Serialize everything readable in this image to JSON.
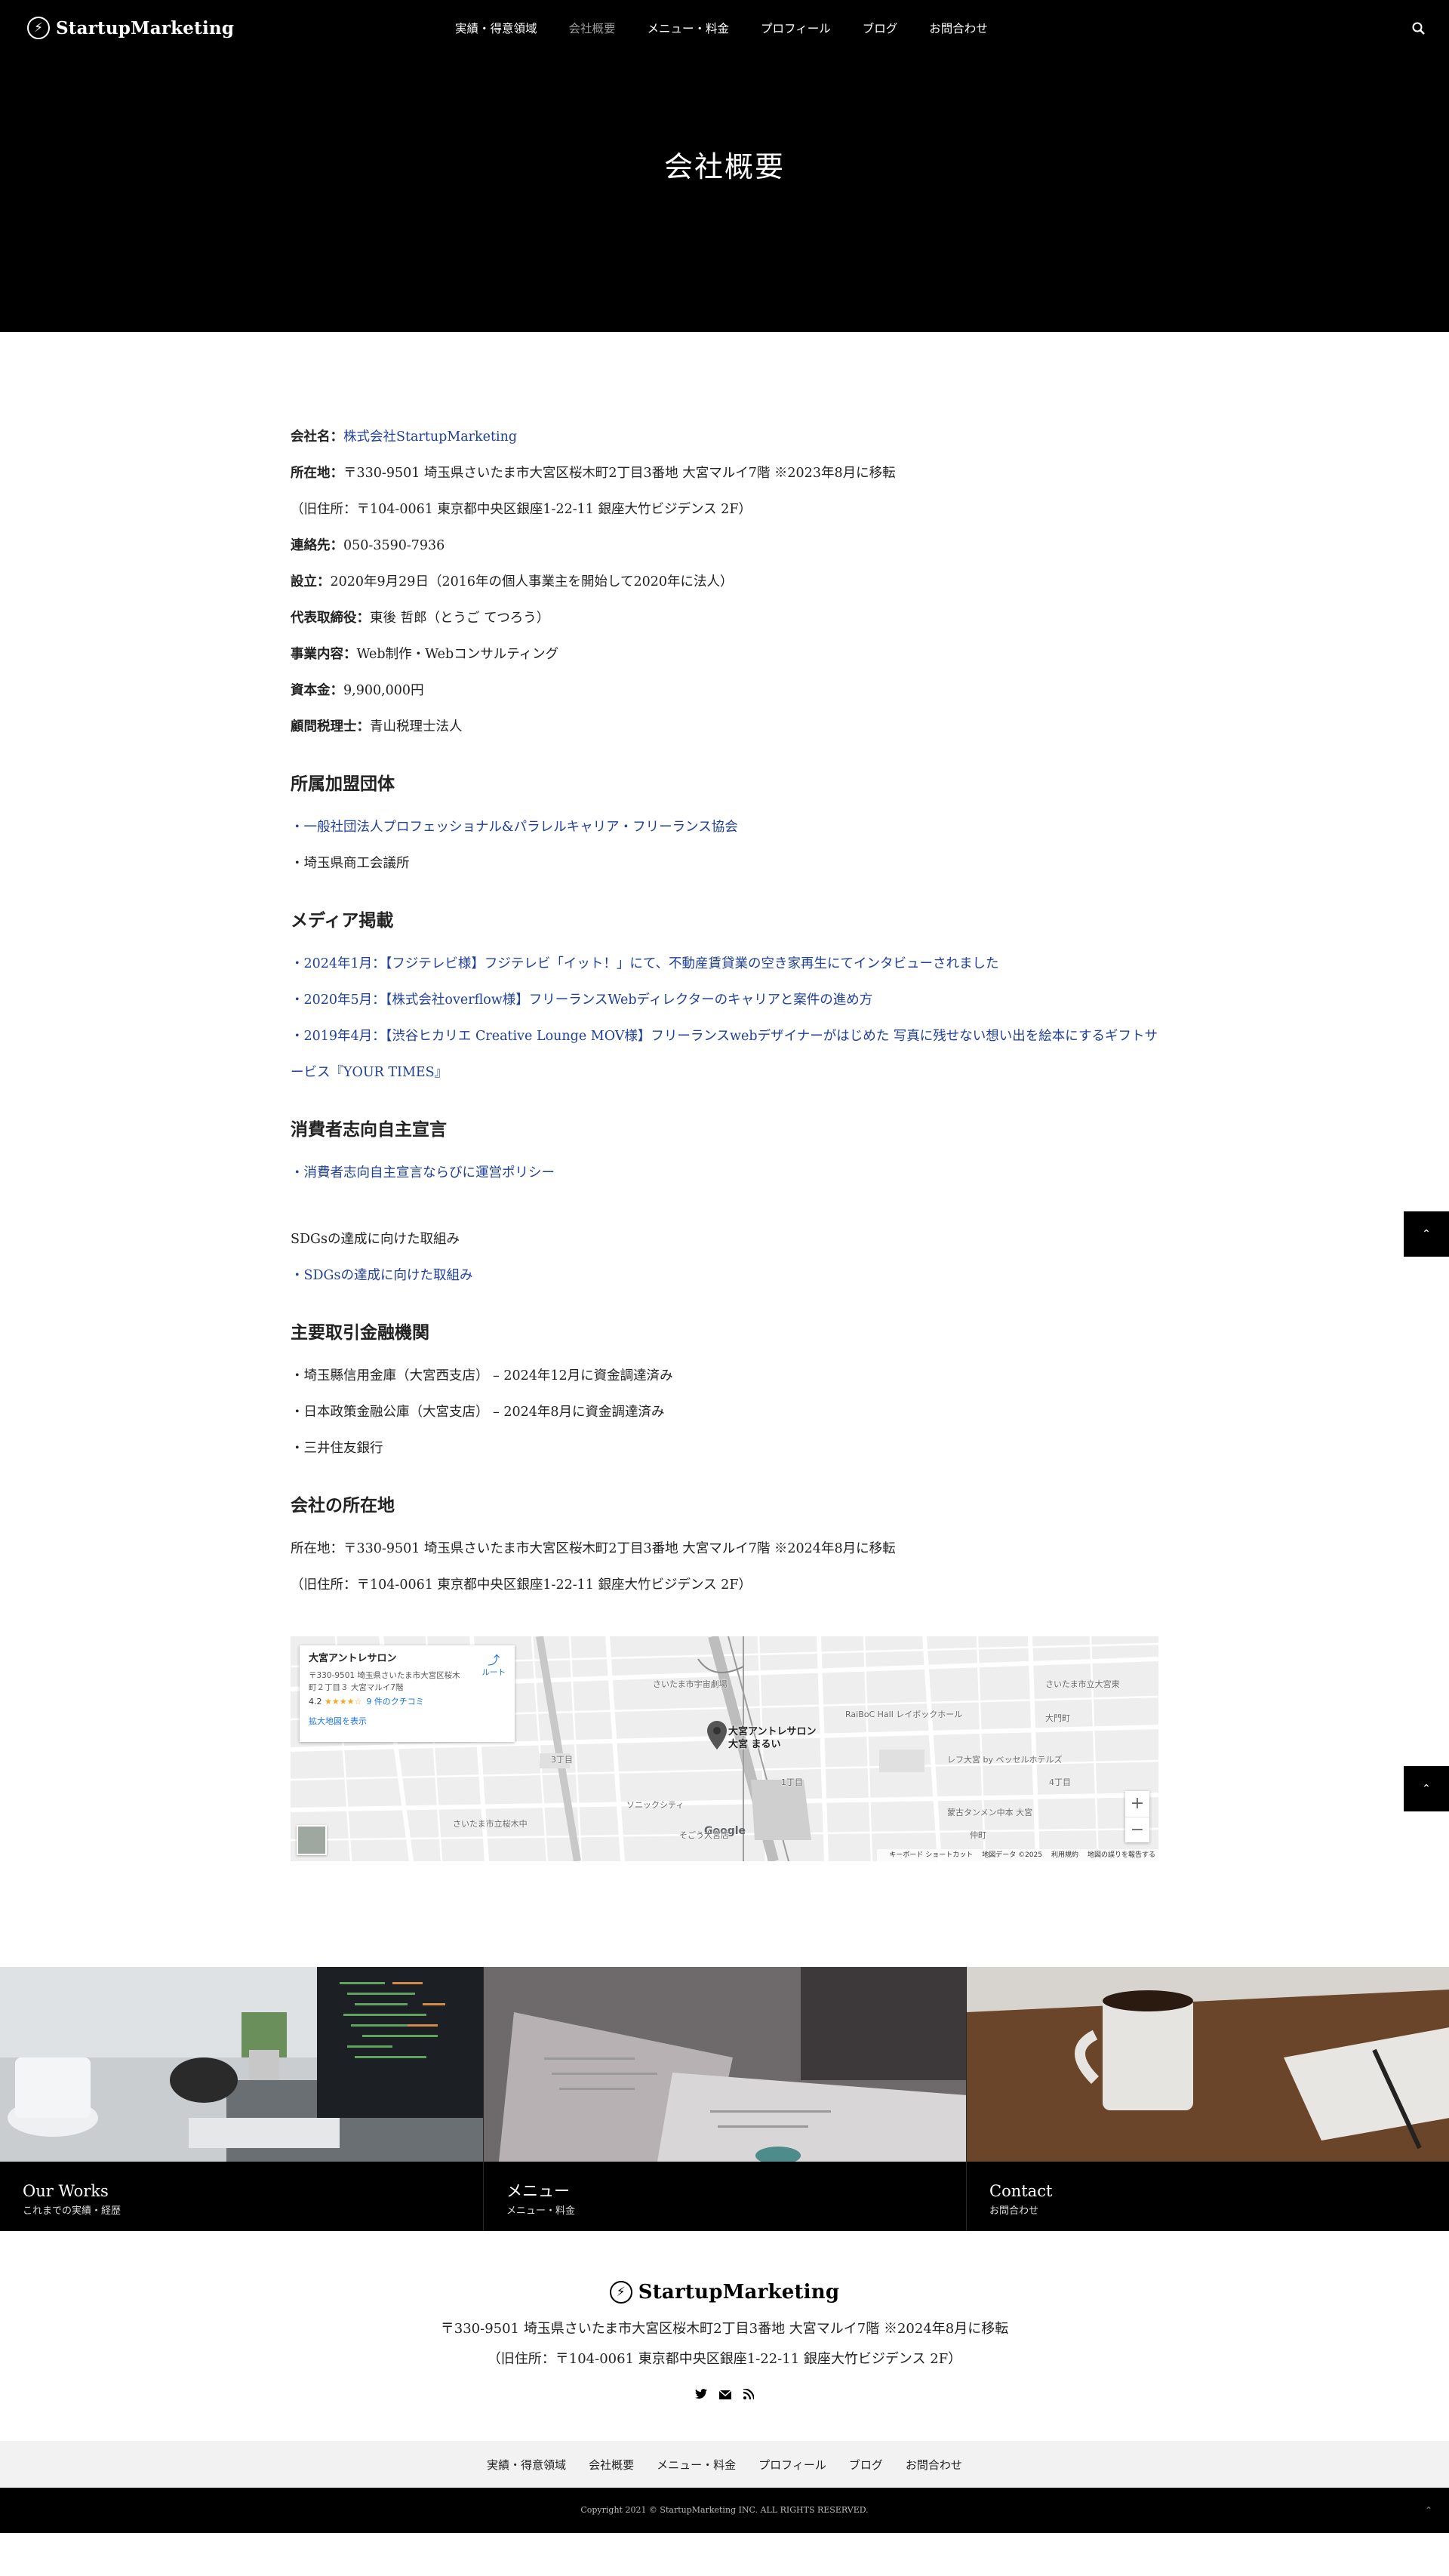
{
  "header": {
    "logo_text": "StartupMarketing",
    "nav": [
      "実績・得意領域",
      "会社概要",
      "メニュー・料金",
      "プロフィール",
      "ブログ",
      "お問合わせ"
    ],
    "page_title": "会社概要"
  },
  "company": {
    "name_label": "会社名：",
    "name_value": "株式会社StartupMarketing",
    "address_label": "所在地：",
    "address_value": "〒330-9501 埼玉県さいたま市大宮区桜木町2丁目3番地 大宮マルイ7階 ※2023年8月に移転",
    "old_address": "（旧住所：〒104-0061 東京都中央区銀座1-22-11 銀座大竹ビジデンス 2F）",
    "contact_label": "連絡先：",
    "contact_value": "050-3590-7936",
    "founded_label": "設立：",
    "founded_value": "2020年9月29日（2016年の個人事業主を開始して2020年に法人）",
    "ceo_label": "代表取締役：",
    "ceo_value": "東後 哲郎（とうご てつろう）",
    "business_label": "事業内容：",
    "business_value": "Web制作・Webコンサルティング",
    "capital_label": "資本金：",
    "capital_value": "9,900,000円",
    "tax_label": "顧問税理士：",
    "tax_value": "青山税理士法人"
  },
  "memberships": {
    "heading": "所属加盟団体",
    "items": [
      "・一般社団法人プロフェッショナル&パラレルキャリア・フリーランス協会",
      "・埼玉県商工会議所"
    ]
  },
  "media": {
    "heading": "メディア掲載",
    "items": [
      "・2024年1月：【フジテレビ様】フジテレビ「イット！」にて、不動産賃貸業の空き家再生にてインタビューされました",
      "・2020年5月：【株式会社overflow様】フリーランスWebディレクターのキャリアと案件の進め方",
      "・2019年4月：【渋谷ヒカリエ Creative Lounge MOV様】フリーランスwebデザイナーがはじめた 写真に残せない想い出を絵本にするギフトサービス『YOUR TIMES』"
    ]
  },
  "consumer": {
    "heading": "消費者志向自主宣言",
    "link": "・消費者志向自主宣言ならびに運営ポリシー"
  },
  "sdgs": {
    "text": "SDGsの達成に向けた取組み",
    "link": "・SDGsの達成に向けた取組み"
  },
  "banks": {
    "heading": "主要取引金融機関",
    "items": [
      "・埼玉縣信用金庫（大宮西支店） – 2024年12月に資金調達済み",
      "・日本政策金融公庫（大宮支店） – 2024年8月に資金調達済み",
      "・三井住友銀行"
    ]
  },
  "location": {
    "heading": "会社の所在地",
    "address": "所在地：〒330-9501 埼玉県さいたま市大宮区桜木町2丁目3番地 大宮マルイ7階 ※2024年8月に移転",
    "old_address": "（旧住所：〒104-0061 東京都中央区銀座1-22-11 銀座大竹ビジデンス 2F）"
  },
  "map": {
    "place_name": "大宮アントレサロン",
    "place_address": "〒330-9501 埼玉県さいたま市大宮区桜木町２丁目３ 大宮マルイ7階",
    "rating": "4.2",
    "stars": "★★★★☆",
    "reviews": "9 件のクチコミ",
    "view_larger": "拡大地図を表示",
    "route": "ルート",
    "pin_label_1": "大宮アントレサロン",
    "pin_label_2": "大宮 まるい",
    "labels": [
      "さいたま市宇宙劇場",
      "さいたま市立桜木中",
      "ソニックシティ",
      "RaiBoC Hall レイボックホール",
      "レフ大宮 by ベッセルホテルズ",
      "蒙古タンメン中本 大宮",
      "そごう大宮店",
      "さいたま市立大宮東",
      "大門町",
      "仲町",
      "1丁目",
      "2丁目",
      "3丁目",
      "4丁目"
    ],
    "google": "Google",
    "footer": [
      "キーボード ショートカット",
      "地図データ ©2025",
      "利用規約",
      "地図の誤りを報告する"
    ],
    "zoom_in": "+",
    "zoom_out": "−"
  },
  "cards": [
    {
      "title": "Our Works",
      "sub": "これまでの実績・経歴"
    },
    {
      "title": "メニュー",
      "sub": "メニュー・料金"
    },
    {
      "title": "Contact",
      "sub": "お問合わせ"
    }
  ],
  "footer": {
    "logo_text": "StartupMarketing",
    "address": "〒330-9501 埼玉県さいたま市大宮区桜木町2丁目3番地 大宮マルイ7階 ※2024年8月に移転",
    "old_address": "（旧住所：〒104-0061 東京都中央区銀座1-22-11 銀座大竹ビジデンス 2F）",
    "nav": [
      "実績・得意領域",
      "会社概要",
      "メニュー・料金",
      "プロフィール",
      "ブログ",
      "お問合わせ"
    ],
    "copyright": "Copyright 2021 © StartupMarketing INC. ALL RIGHTS RESERVED."
  },
  "icons": {
    "search": "search-icon",
    "twitter": "twitter-icon",
    "mail": "mail-icon",
    "rss": "rss-icon",
    "pagetop": "chevron-up-icon"
  }
}
